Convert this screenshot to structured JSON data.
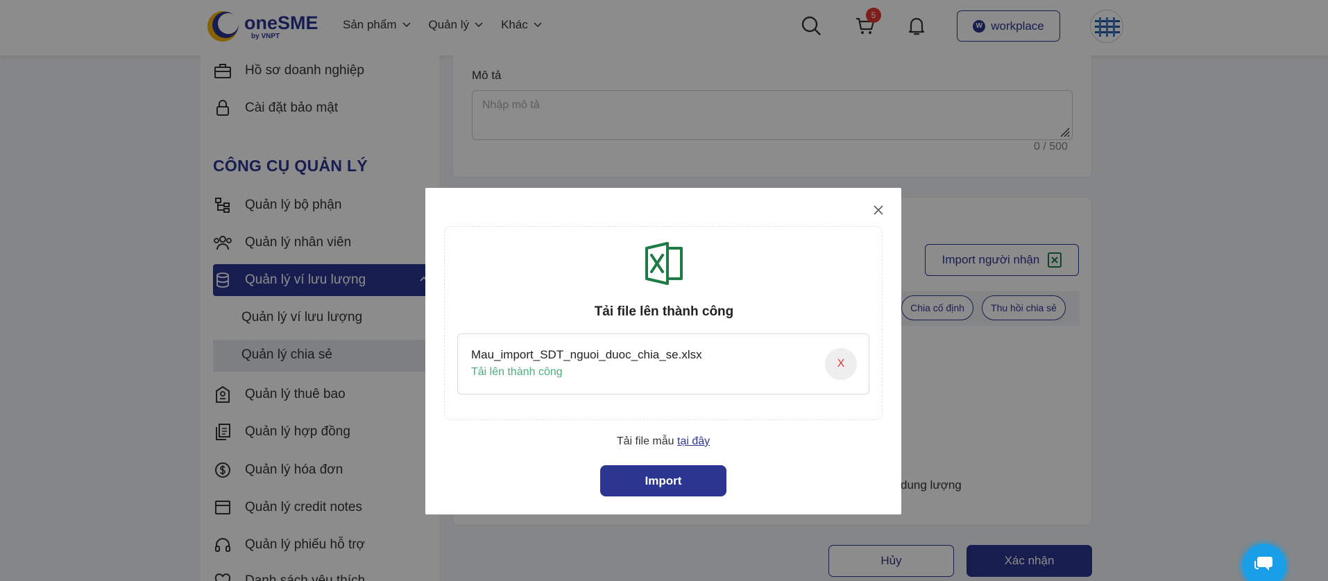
{
  "header": {
    "logo_name": "oneSME",
    "logo_by": "by VNPT",
    "nav": [
      {
        "label": "Sản phẩm"
      },
      {
        "label": "Quản lý"
      },
      {
        "label": "Khác"
      }
    ],
    "cart_count": "5",
    "workplace_label": "workplace",
    "workplace_badge": "W"
  },
  "sidebar": {
    "top_items": [
      {
        "label": "Hồ sơ doanh nghiệp",
        "icon": "briefcase-icon"
      },
      {
        "label": "Cài đặt bảo mật",
        "icon": "lock-icon"
      }
    ],
    "heading": "CÔNG CỤ QUẢN LÝ",
    "items": [
      {
        "label": "Quản lý bộ phận",
        "icon": "org-chart-icon"
      },
      {
        "label": "Quản lý nhân viên",
        "icon": "users-icon"
      },
      {
        "label": "Quản lý ví lưu lượng",
        "icon": "database-icon"
      },
      {
        "label": "Quản lý ví lưu lượng"
      },
      {
        "label": "Quản lý chia sẻ"
      },
      {
        "label": "Quản lý thuê bao",
        "icon": "subscription-icon"
      },
      {
        "label": "Quản lý hợp đồng",
        "icon": "contract-icon"
      },
      {
        "label": "Quản lý hóa đơn",
        "icon": "dollar-icon"
      },
      {
        "label": "Quản lý credit notes",
        "icon": "credit-note-icon"
      },
      {
        "label": "Quản lý phiếu hỗ trợ",
        "icon": "headset-icon"
      },
      {
        "label": "Danh sách yêu thích",
        "icon": "heart-icon"
      }
    ]
  },
  "form": {
    "description_label": "Mô tả",
    "description_placeholder": "Nhập mô tả",
    "counter": "0 / 500",
    "import_recipients_label": "Import người nhận",
    "pill_fixed": "Chia cố định",
    "pill_revoke": "Thu hồi chia sẻ",
    "capacity_text": "dung lượng",
    "cancel_label": "Hủy",
    "confirm_label": "Xác nhận"
  },
  "modal": {
    "title": "Tải file lên thành công",
    "file_name": "Mau_import_SDT_nguoi_duoc_chia_se.xlsx",
    "file_status": "Tải lên thành công",
    "remove_label": "X",
    "template_prefix": "Tải file mẫu",
    "template_link": "tại đây",
    "import_label": "Import"
  },
  "colors": {
    "brand": "#2c3691",
    "success": "#4caf7a",
    "excel": "#1e7b45",
    "danger": "#e53935"
  }
}
